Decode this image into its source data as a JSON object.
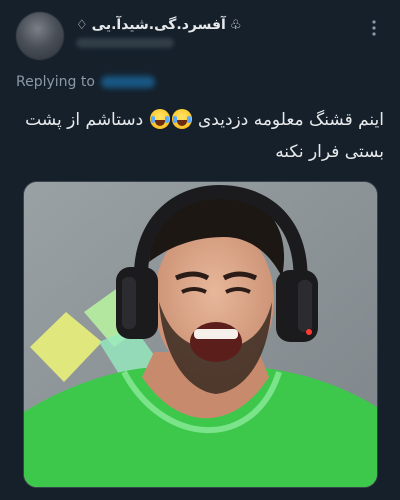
{
  "author": {
    "display_name": "آفسرد.گی.شیدآ.یی",
    "suit_left": "♢",
    "suit_right": "♧"
  },
  "more_icon": "more-vertical-icon",
  "reply": {
    "label": "Replying to"
  },
  "tweet": {
    "line1_part1": "اینم قشنگ معلومه دزدیدی",
    "line1_part2": "دستاشم از پشت",
    "line2": "بستی فرار نکنه",
    "emoji": "tears-of-joy-emoji"
  },
  "media": {
    "description_icon": "photo"
  },
  "colors": {
    "background": "#15202b",
    "text": "#e7e9ea",
    "secondary": "#8b98a5",
    "accent": "#1d9bf0"
  }
}
